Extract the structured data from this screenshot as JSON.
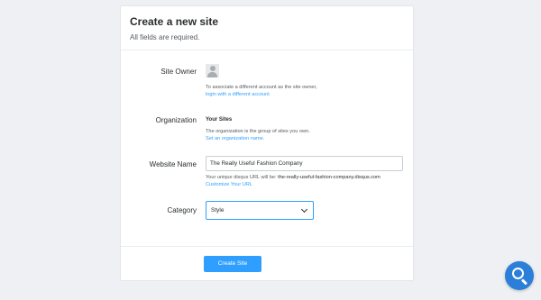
{
  "header": {
    "title": "Create a new site",
    "subtitle": "All fields are required."
  },
  "owner": {
    "label": "Site Owner",
    "help": "To associate a different account as the site owner,",
    "link": "login with a different account"
  },
  "organization": {
    "label": "Organization",
    "value": "Your Sites",
    "help": "The organization is the group of sites you own.",
    "link": "Set an organization name."
  },
  "website": {
    "label": "Website Name",
    "value": "The Really Useful Fashion Company",
    "help_prefix": "Your unique disqus URL will be: ",
    "url": "the-really-useful-fashion-company.disqus.com",
    "link": "Customize Your URL"
  },
  "category": {
    "label": "Category",
    "selected": "Style"
  },
  "actions": {
    "create_label": "Create Site"
  },
  "colors": {
    "accent": "#2e9fff",
    "fab": "#2b7fd8"
  },
  "icons": {
    "avatar": "user-avatar-placeholder",
    "fab": "search-icon"
  }
}
